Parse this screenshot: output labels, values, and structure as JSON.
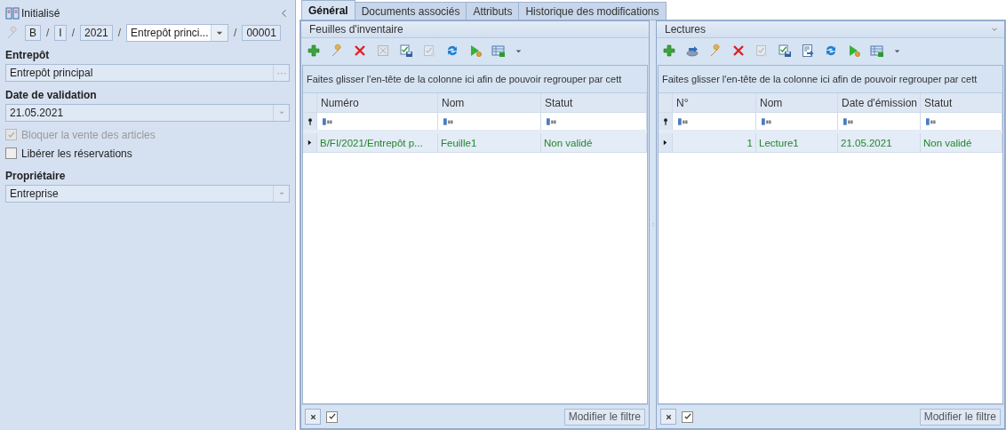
{
  "document": {
    "status": "Initialisé"
  },
  "number": [
    {
      "kind": "box",
      "text": "B"
    },
    {
      "kind": "sep",
      "text": "/"
    },
    {
      "kind": "box",
      "text": "I"
    },
    {
      "kind": "sep",
      "text": "/"
    },
    {
      "kind": "box",
      "text": "2021"
    },
    {
      "kind": "sep",
      "text": "/"
    },
    {
      "kind": "combo",
      "text": "Entrepôt princi..."
    },
    {
      "kind": "sep",
      "text": "/"
    },
    {
      "kind": "box",
      "text": "00001"
    }
  ],
  "warehouse": {
    "label": "Entrepôt",
    "value": "Entrepôt principal"
  },
  "validation_date": {
    "label": "Date de validation",
    "value": "21.05.2021"
  },
  "options": [
    {
      "label": "Bloquer la vente des articles",
      "checked": true,
      "disabled": true
    },
    {
      "label": "Libérer les réservations",
      "checked": false,
      "disabled": false
    }
  ],
  "owner": {
    "label": "Propriétaire",
    "value": "Entreprise"
  },
  "tabs": [
    {
      "label": "Général",
      "selected": true
    },
    {
      "label": "Documents associés",
      "selected": false
    },
    {
      "label": "Attributs",
      "selected": false
    },
    {
      "label": "Historique des modifications",
      "selected": false
    }
  ],
  "panels": [
    {
      "title": "Feuilles d'inventaire",
      "collapsible": false,
      "toolbar": [
        {
          "kind": "add",
          "disabled": false
        },
        {
          "kind": "edit",
          "disabled": false
        },
        {
          "kind": "delete",
          "disabled": false
        },
        {
          "kind": "cancel",
          "disabled": true
        },
        {
          "kind": "save",
          "disabled": false
        },
        {
          "kind": "approve",
          "disabled": true
        },
        {
          "kind": "refresh",
          "disabled": false
        },
        {
          "kind": "run",
          "disabled": false
        },
        {
          "kind": "view",
          "disabled": false
        }
      ],
      "group_hint": "Faites glisser l'en-tête de la colonne ici afin de pouvoir regrouper par cett",
      "columns": [
        {
          "label": "Numéro",
          "kind": "text"
        },
        {
          "label": "Nom",
          "kind": "text"
        },
        {
          "label": "Statut",
          "kind": "text"
        }
      ],
      "rows": [
        {
          "cells": [
            "B/FI/2021/Entrepôt p...",
            "Feuille1",
            "Non validé"
          ],
          "selected": true
        }
      ],
      "filter_enabled": true,
      "filter_button": "Modifier le filtre"
    },
    {
      "title": "Lectures",
      "collapsible": true,
      "toolbar": [
        {
          "kind": "add",
          "disabled": false
        },
        {
          "kind": "import",
          "disabled": false
        },
        {
          "kind": "edit",
          "disabled": false
        },
        {
          "kind": "delete",
          "disabled": false
        },
        {
          "kind": "approve",
          "disabled": true
        },
        {
          "kind": "save",
          "disabled": false
        },
        {
          "kind": "export",
          "disabled": false
        },
        {
          "kind": "refresh",
          "disabled": false
        },
        {
          "kind": "run",
          "disabled": false
        },
        {
          "kind": "view",
          "disabled": false
        }
      ],
      "group_hint": "Faites glisser l'en-tête de la colonne ici afin de pouvoir regrouper par cett",
      "columns": [
        {
          "label": "N°",
          "kind": "number"
        },
        {
          "label": "Nom",
          "kind": "text"
        },
        {
          "label": "Date d'émission",
          "kind": "text"
        },
        {
          "label": "Statut",
          "kind": "text"
        }
      ],
      "rows": [
        {
          "cells": [
            "1",
            "Lecture1",
            "21.05.2021",
            "Non validé"
          ],
          "selected": true
        }
      ],
      "filter_enabled": true,
      "filter_button": "Modifier le filtre"
    }
  ]
}
